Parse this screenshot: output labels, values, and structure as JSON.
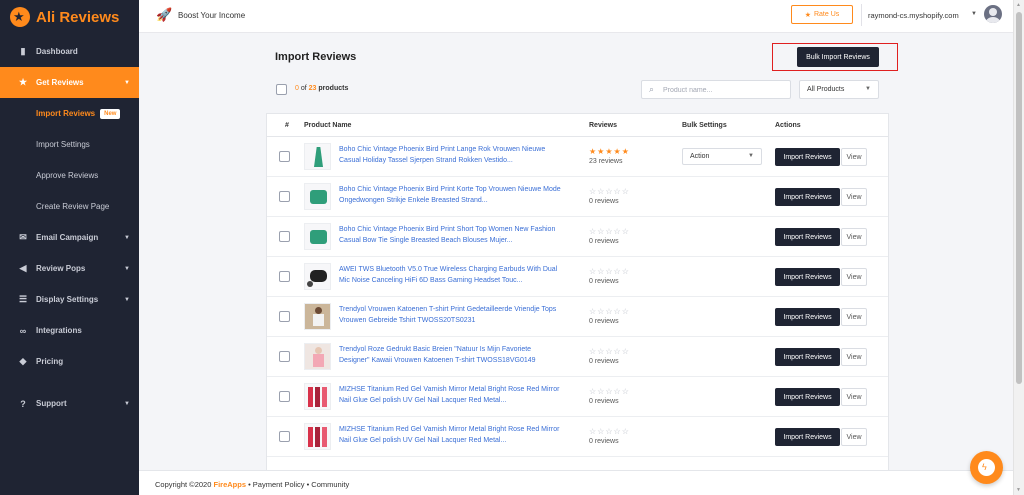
{
  "brand": {
    "name": "Ali Reviews",
    "accent": "#ff8a1c"
  },
  "sidebar": {
    "items": [
      {
        "label": "Dashboard",
        "icon": "bar-chart-icon"
      },
      {
        "label": "Get Reviews",
        "icon": "star-icon",
        "active": true
      },
      {
        "label": "Email Campaign",
        "icon": "envelope-icon"
      },
      {
        "label": "Review Pops",
        "icon": "megaphone-icon"
      },
      {
        "label": "Display Settings",
        "icon": "sliders-icon"
      },
      {
        "label": "Integrations",
        "icon": "link-icon"
      },
      {
        "label": "Pricing",
        "icon": "tag-icon"
      },
      {
        "label": "Support",
        "icon": "help-icon"
      }
    ],
    "sub_items": [
      {
        "label": "Import Reviews",
        "badge": "New",
        "active": true
      },
      {
        "label": "Import Settings"
      },
      {
        "label": "Approve Reviews"
      },
      {
        "label": "Create Review Page"
      }
    ]
  },
  "header": {
    "title": "Boost Your Income",
    "rate_label": "Rate Us",
    "shop": "raymond-cs.myshopify.com"
  },
  "main": {
    "title": "Import Reviews",
    "bulk_button": "Bulk Import Reviews",
    "selected_count": "0",
    "total_count": "23",
    "count_of": "of",
    "count_suffix": "products",
    "search_placeholder": "Product name...",
    "filter_value": "All Products"
  },
  "table": {
    "headers": {
      "index": "#",
      "name": "Product Name",
      "reviews": "Reviews",
      "bulk": "Bulk Settings",
      "actions": "Actions"
    },
    "action_placeholder": "Action",
    "import_label": "Import Reviews",
    "view_label": "View",
    "rows": [
      {
        "name": "Boho Chic Vintage Phoenix Bird Print Lange Rok Vrouwen Nieuwe Casual Holiday Tassel Sjerpen Strand Rokken Vestido...",
        "rating": 5,
        "reviews": "23 reviews",
        "has_action": true,
        "thumb": "green-skirt"
      },
      {
        "name": "Boho Chic Vintage Phoenix Bird Print Korte Top Vrouwen Nieuwe Mode Ongedwongen Strikje Enkele Breasted Strand...",
        "rating": 0,
        "reviews": "0 reviews",
        "has_action": false,
        "thumb": "green-top"
      },
      {
        "name": "Boho Chic Vintage Phoenix Bird Print Short Top Women New Fashion Casual Bow Tie Single Breasted Beach Blouses Mujer...",
        "rating": 0,
        "reviews": "0 reviews",
        "has_action": false,
        "thumb": "green-top"
      },
      {
        "name": "AWEI TWS Bluetooth V5.0 True Wireless Charging Earbuds With Dual Mic Noise Canceling HiFi 6D Bass Gaming Headset Touc...",
        "rating": 0,
        "reviews": "0 reviews",
        "has_action": false,
        "thumb": "earbuds"
      },
      {
        "name": "Trendyol Vrouwen Katoenen T-shirt Print Gedetailleerde Vriendje Tops Vrouwen Gebreide Tshirt TWOSS20TS0231",
        "rating": 0,
        "reviews": "0 reviews",
        "has_action": false,
        "thumb": "tshirt-woman"
      },
      {
        "name": "Trendyol Roze Gedrukt Basic Breien \"Natuur Is Mijn Favoriete Designer\" Kawaii Vrouwen Katoenen T-shirt TWOSS18VG0149",
        "rating": 0,
        "reviews": "0 reviews",
        "has_action": false,
        "thumb": "pink-woman"
      },
      {
        "name": "MIZHSE Titanium Red Gel Varnish Mirror Metal Bright Rose Red Mirror Nail Glue Gel polish UV Gel Nail Lacquer Red Metal...",
        "rating": 0,
        "reviews": "0 reviews",
        "has_action": false,
        "thumb": "nail-polish"
      },
      {
        "name": "MIZHSE Titanium Red Gel Varnish Mirror Metal Bright Rose Red Mirror Nail Glue Gel polish UV Gel Nail Lacquer Red Metal...",
        "rating": 0,
        "reviews": "0 reviews",
        "has_action": false,
        "thumb": "nail-polish"
      }
    ]
  },
  "footer": {
    "copyright": "Copyright ©2020 ",
    "company": "FireApps",
    "links": " • Payment Policy • Community"
  }
}
